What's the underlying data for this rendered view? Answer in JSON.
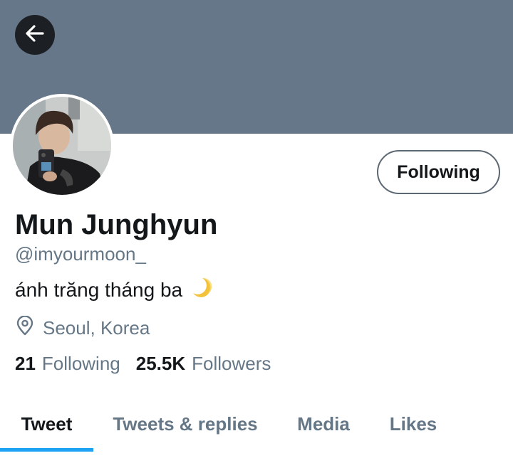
{
  "header": {
    "banner_color": "#657789",
    "back_icon": "arrow-left-icon"
  },
  "profile": {
    "display_name": "Mun Junghyun",
    "handle": "@imyourmoon_",
    "bio": "ánh trăng tháng ba",
    "bio_emoji": "crescent-moon-icon",
    "location": "Seoul, Korea",
    "location_icon": "map-pin-icon",
    "follow_button_label": "Following"
  },
  "stats": [
    {
      "value": "21",
      "label": "Following"
    },
    {
      "value": "25.5K",
      "label": "Followers"
    }
  ],
  "tabs": [
    {
      "label": "Tweet",
      "active": true
    },
    {
      "label": "Tweets & replies",
      "active": false
    },
    {
      "label": "Media",
      "active": false
    },
    {
      "label": "Likes",
      "active": false
    }
  ],
  "colors": {
    "accent": "#1da1f2",
    "primary_text": "#14171a",
    "secondary_text": "#657786"
  }
}
